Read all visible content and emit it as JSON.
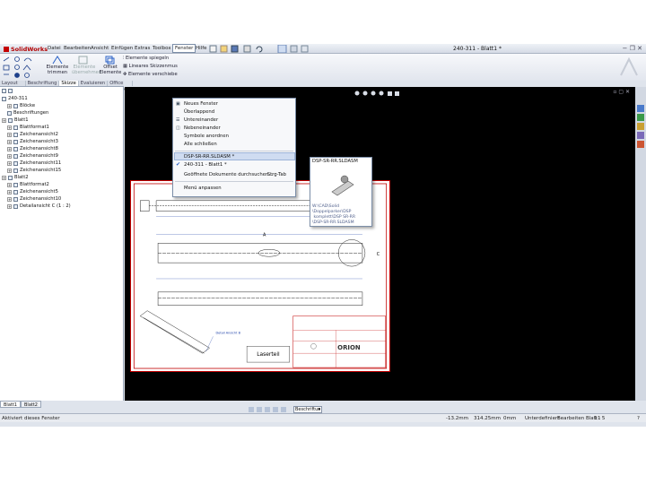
{
  "app": {
    "logo": "SolidWorks",
    "doc_title": "240-311 - Blatt1 *"
  },
  "menu": [
    "Datei",
    "Bearbeiten",
    "Ansicht",
    "Einfügen",
    "Extras",
    "Toolbox",
    "Fenster",
    "Hilfe"
  ],
  "ribbon": {
    "trim": "Elemente trimmen",
    "convert": "Elemente übernehmen",
    "offset": "Offset Elemente",
    "mirror": "Elemente spiegeln",
    "linear_pattern": "Lineares Skizzenmus",
    "move": "Elemente verschiebe"
  },
  "tabs": [
    "Layout anzeigen",
    "Beschriftung",
    "Skizze",
    "Evaluieren",
    "Office Produkte"
  ],
  "tree": [
    {
      "label": "240-311",
      "indent": 0,
      "exp": false
    },
    {
      "label": "Blöcke",
      "indent": 1,
      "exp": true
    },
    {
      "label": "Beschriftungen",
      "indent": 1,
      "exp": false
    },
    {
      "label": "Blatt1",
      "indent": 0,
      "exp": true
    },
    {
      "label": "Blattformat1",
      "indent": 1,
      "exp": true
    },
    {
      "label": "Zeichenansicht2",
      "indent": 1,
      "exp": true
    },
    {
      "label": "Zeichenansicht3",
      "indent": 1,
      "exp": true
    },
    {
      "label": "Zeichenansicht8",
      "indent": 1,
      "exp": true
    },
    {
      "label": "Zeichenansicht9",
      "indent": 1,
      "exp": true
    },
    {
      "label": "Zeichenansicht11",
      "indent": 1,
      "exp": true
    },
    {
      "label": "Zeichenansicht15",
      "indent": 1,
      "exp": true
    },
    {
      "label": "Blatt2",
      "indent": 0,
      "exp": true
    },
    {
      "label": "Blattformat2",
      "indent": 1,
      "exp": true
    },
    {
      "label": "Zeichenansicht5",
      "indent": 1,
      "exp": true
    },
    {
      "label": "Zeichenansicht10",
      "indent": 1,
      "exp": true
    },
    {
      "label": "Detailansicht C (1 : 2)",
      "indent": 1,
      "exp": true
    }
  ],
  "window_menu": {
    "new_window": "Neues Fenster",
    "cascade": "Überlappend",
    "tile_h": "Untereinander",
    "tile_v": "Nebeneinander",
    "arrange": "Symbole anordnen",
    "close_all": "Alle schließen",
    "doc1": "DSP-SR-RR.SLDASM *",
    "doc2": "240-311 - Blatt1 *",
    "browse": "Geöffnete Dokumente durchsuchen...",
    "browse_shortcut": "Strg-Tab",
    "customize": "Menü anpassen"
  },
  "tooltip": {
    "title": "DSP-SR-RR.SLDASM",
    "path": "W:\\CAD\\Solid\n\\Doppelparker\\DSP\n komplett\\DSP SR-RR\n\\DSP-SR-RR.SLDASM"
  },
  "drawing": {
    "section_label": "A",
    "detail_label": "C",
    "note_label": "Laserteil",
    "brand": "ORION",
    "view_label": "Detail Ansicht B"
  },
  "sheet_tabs": [
    "Blatt1",
    "Blatt2"
  ],
  "bottom_dropdown": "Beschriftun",
  "status": {
    "hint": "Aktiviert dieses Fenster",
    "x": "-13.2mm",
    "y": "314.25mm",
    "z": "0mm",
    "defined": "Unterdefiniert",
    "editing": "Bearbeiten Blatt1",
    "scale": "1 : 5"
  },
  "colors": {
    "accent": "#c40000",
    "sheet_border": "#c00000",
    "canvas": "#000000",
    "selection": "#cfdcf1"
  }
}
